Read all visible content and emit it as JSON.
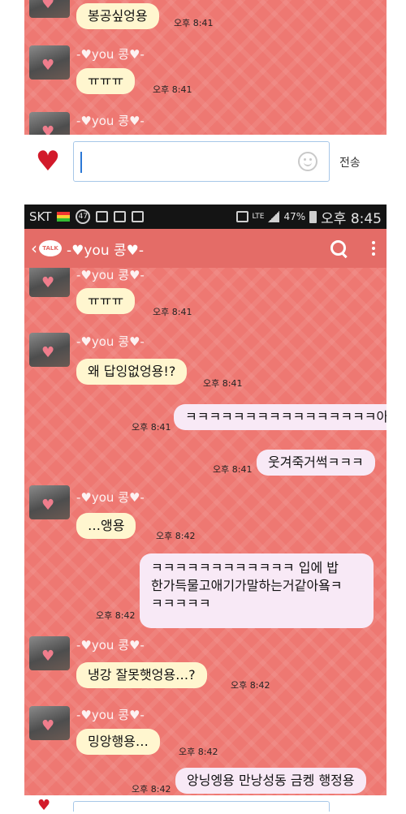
{
  "screen1": {
    "messages": [
      {
        "type": "in",
        "text": "봉공싶엉용",
        "time": "오후 8:41"
      },
      {
        "type": "sender",
        "name": "-♥you 콩♥-"
      },
      {
        "type": "in",
        "text": "ㅠㅠㅠ",
        "time": "오후 8:41"
      },
      {
        "type": "sender",
        "name": "-♥you 콩♥-"
      }
    ]
  },
  "input_bar": {
    "heart_icon": "♥",
    "send_label": "전송"
  },
  "status_bar": {
    "carrier": "SKT",
    "badge": "47",
    "network": "LTE",
    "battery": "47%",
    "time": "오후 8:45"
  },
  "app_bar": {
    "logo_text": "TALK",
    "title": "-♥you 콩♥-"
  },
  "screen2": {
    "sender_name": "-♥you 콩♥-",
    "messages": {
      "m1": {
        "text": "ㅠㅠㅠ",
        "time": "오후 8:41"
      },
      "m2": {
        "text": "왜 답잉없엉용!?",
        "time": "오후 8:41"
      },
      "m3": {
        "text": "ㅋㅋㅋㅋㅋㅋㅋㅋㅋㅋㅋㅋㅋㅋㅋㅋ아",
        "time": "오후 8:41"
      },
      "m4": {
        "text": "웃겨죽거썩ㅋㅋㅋ",
        "time": "오후 8:41"
      },
      "m5": {
        "text": "…앵용",
        "time": "오후 8:42"
      },
      "m6": {
        "lines": [
          "ㅋㅋㅋㅋㅋㅋㅋㅋㅋㅋㅋㅋ 입에 밥",
          "한가득물고애기가말하는거같아욬ㅋ",
          "ㅋㅋㅋㅋㅋ"
        ],
        "time": "오후 8:42"
      },
      "m7": {
        "text": "냉강 잘못햇엉용…?",
        "time": "오후 8:42"
      },
      "m8": {
        "text": "밍앙행용…",
        "time": "오후 8:42"
      },
      "m9": {
        "text": "앙닝엥용 만낭성동 금켕 행정용",
        "time": "오후 8:42"
      }
    }
  },
  "colors": {
    "chat_bg": "#ee7872",
    "appbar": "#e46c67",
    "incoming": "#fff6cf",
    "outgoing": "#f8e9f6",
    "heart": "#d21a2a"
  }
}
